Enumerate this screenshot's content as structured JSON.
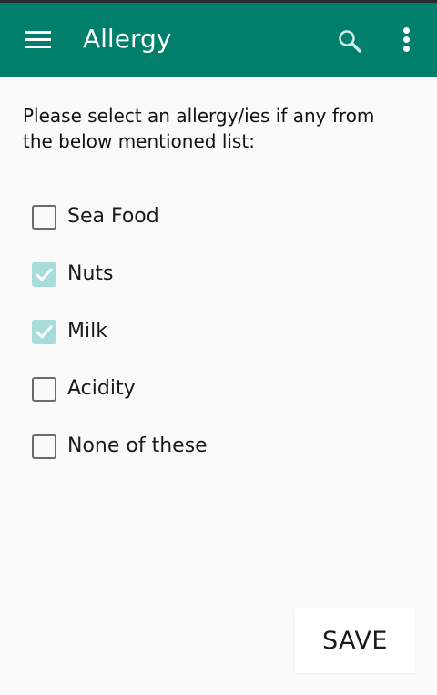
{
  "app_bar": {
    "title": "Allergy",
    "background_color": "#00806c",
    "icons": [
      "menu-icon",
      "search-icon",
      "overflow-menu-icon"
    ]
  },
  "prompt": {
    "text": "Please select an allergy/ies if any from the below mentioned list:"
  },
  "options": [
    {
      "label": "Sea Food",
      "checked": false
    },
    {
      "label": "Nuts",
      "checked": true
    },
    {
      "label": "Milk",
      "checked": true
    },
    {
      "label": "Acidity",
      "checked": false
    },
    {
      "label": "None of these",
      "checked": false
    }
  ],
  "checkbox_checked_color": "#a8dcdb",
  "save_button": {
    "label": "SAVE"
  }
}
